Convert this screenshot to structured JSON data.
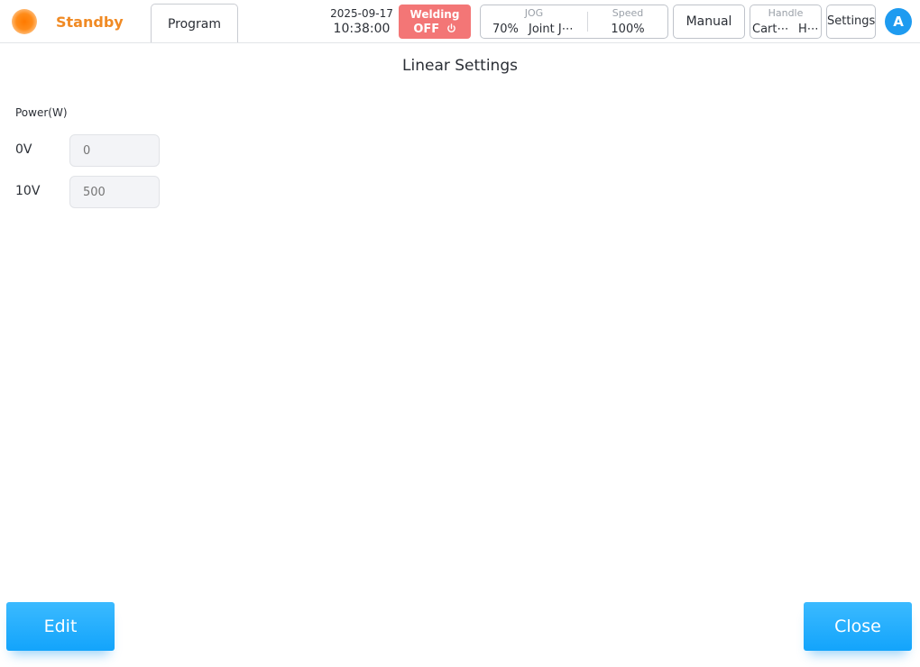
{
  "header": {
    "status": "Standby",
    "tab_program": "Program",
    "date": "2025-09-17",
    "time": "10:38:00",
    "welding": {
      "label": "Welding",
      "value": "OFF"
    },
    "jog": {
      "label": "JOG",
      "percent": "70%",
      "mode": "Joint J⋯"
    },
    "speed": {
      "label": "Speed",
      "value": "100%"
    },
    "manual": "Manual",
    "handle": {
      "label": "Handle",
      "coord": "Cart⋯",
      "value": "H⋯"
    },
    "settings": "Settings",
    "avatar": "A"
  },
  "page": {
    "title": "Linear Settings",
    "section": "Power(W)",
    "rows": [
      {
        "label": "0V",
        "placeholder": "0"
      },
      {
        "label": "10V",
        "placeholder": "500"
      }
    ]
  },
  "footer": {
    "edit": "Edit",
    "close": "Close"
  },
  "colors": {
    "accent": "#1e9bf0",
    "status": "#f08a24",
    "welding_off": "#f37676"
  }
}
